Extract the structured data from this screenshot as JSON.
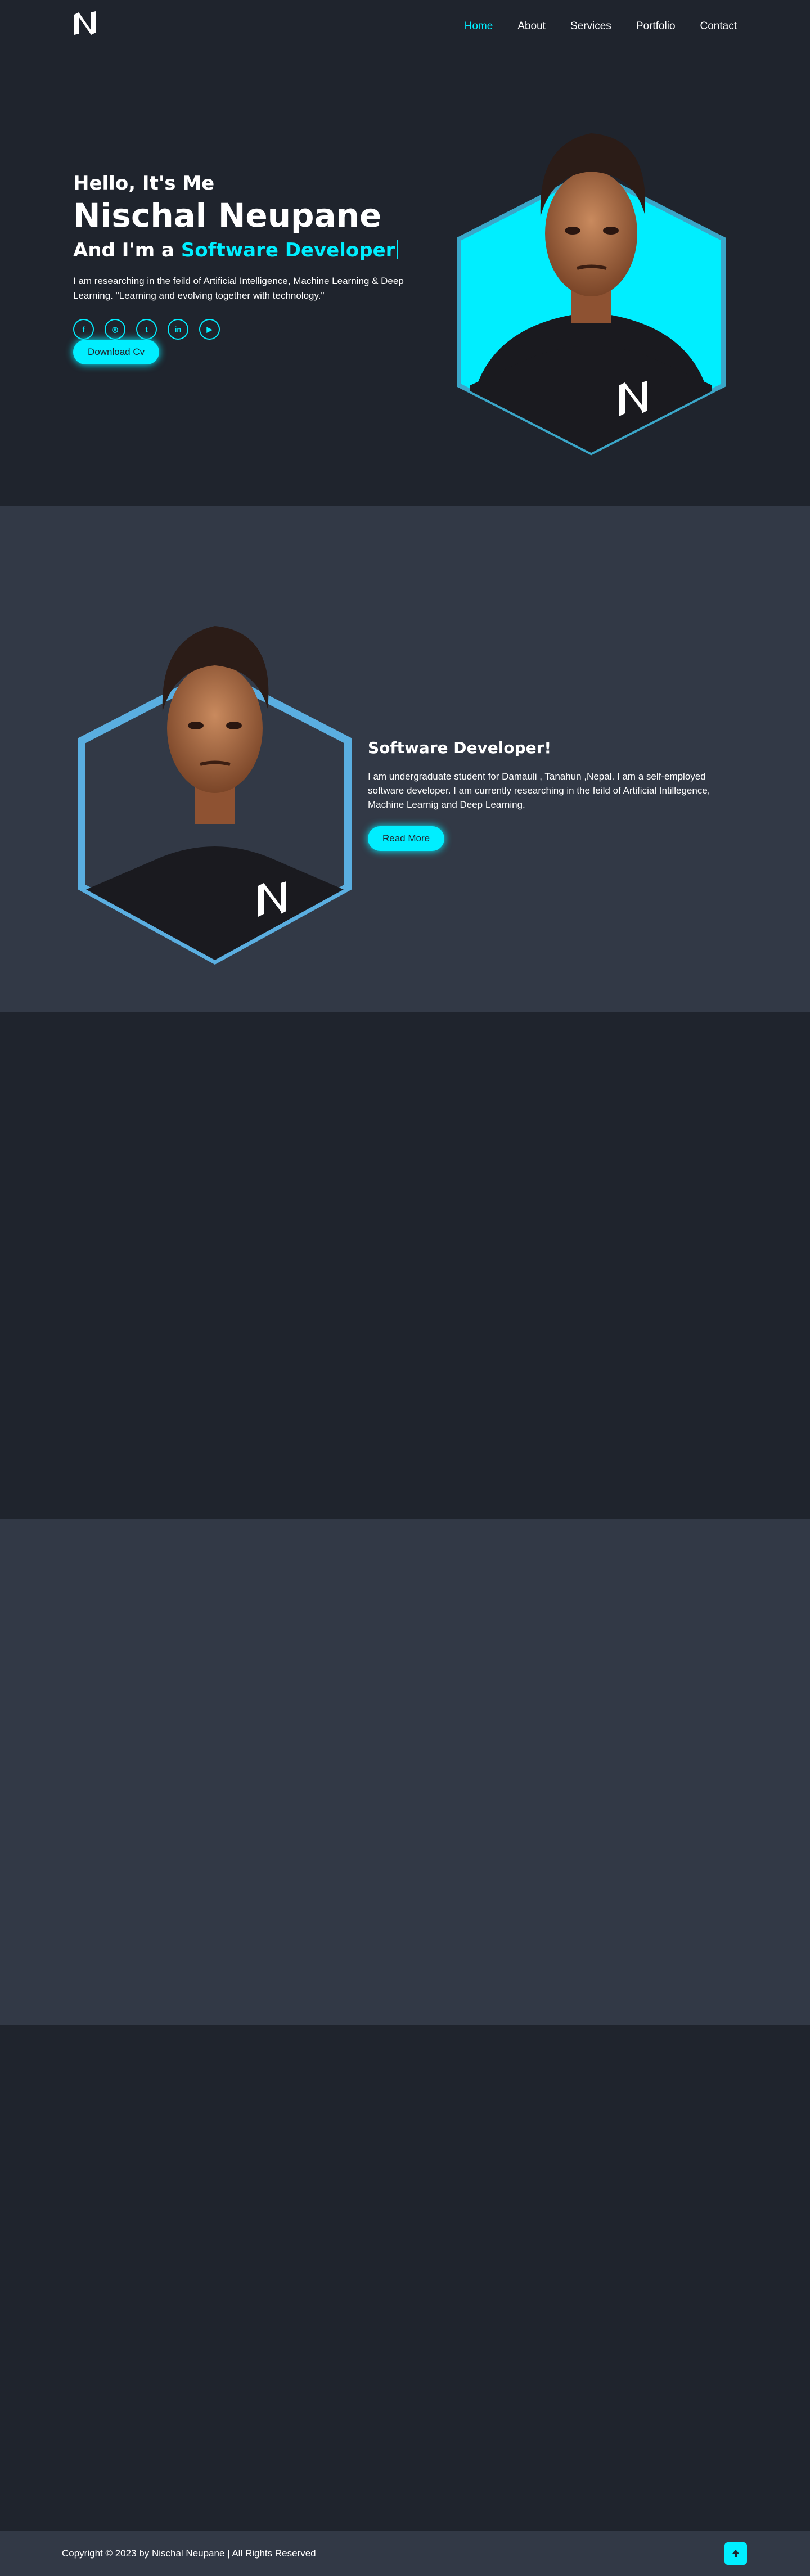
{
  "nav": {
    "items": [
      "Home",
      "About",
      "Services",
      "Portfolio",
      "Contact"
    ],
    "active": "Home"
  },
  "hero": {
    "greeting": "Hello, It's Me",
    "name": "Nischal Neupane",
    "role_prefix": "And I'm a",
    "role": "Software Developer",
    "description": "I am researching in the feild of Artificial Intelligence, Machine Learning & Deep Learning. \"Learning and evolving together with technology.\"",
    "socials": [
      {
        "icon": "facebook-icon",
        "glyph": "f"
      },
      {
        "icon": "instagram-icon",
        "glyph": "◎"
      },
      {
        "icon": "twitter-icon",
        "glyph": "t"
      },
      {
        "icon": "linkedin-icon",
        "glyph": "in"
      },
      {
        "icon": "youtube-icon",
        "glyph": "▶"
      }
    ],
    "cta": "Download Cv"
  },
  "about": {
    "heading": "Software Developer!",
    "text": "I am undergraduate student for Damauli , Tanahun ,Nepal. I am a self-employed software developer. I am currently researching in the feild of Artificial Intillegence, Machine Learnig and Deep Learning.",
    "cta": "Read More"
  },
  "footer": {
    "copyright": "Copyright © 2023 by Nischal Neupane | All Rights Reserved"
  },
  "colors": {
    "accent": "#00eeff",
    "bg": "#1f242d",
    "bg_alt": "#323946",
    "about_frame": "#5aaee0"
  }
}
